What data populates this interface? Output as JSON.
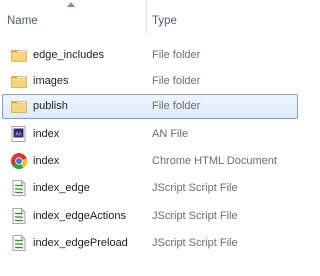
{
  "header": {
    "name_label": "Name",
    "type_label": "Type"
  },
  "files": [
    {
      "name": "edge_includes",
      "type": "File folder",
      "icon": "folder-icon",
      "selected": false
    },
    {
      "name": "images",
      "type": "File folder",
      "icon": "folder-icon",
      "selected": false
    },
    {
      "name": "publish",
      "type": "File folder",
      "icon": "folder-icon",
      "selected": true
    },
    {
      "name": "index",
      "type": "AN File",
      "icon": "an-file-icon",
      "selected": false
    },
    {
      "name": "index",
      "type": "Chrome HTML Document",
      "icon": "chrome-icon",
      "selected": false
    },
    {
      "name": "index_edge",
      "type": "JScript Script File",
      "icon": "script-file-icon",
      "selected": false
    },
    {
      "name": "index_edgeActions",
      "type": "JScript Script File",
      "icon": "script-file-icon",
      "selected": false
    },
    {
      "name": "index_edgePreload",
      "type": "JScript Script File",
      "icon": "script-file-icon",
      "selected": false
    }
  ],
  "colors": {
    "header_text": "#4c607a",
    "selection_border": "#7da2ce",
    "selection_fill": "#dcebfc",
    "folder": "#e8c15a"
  }
}
